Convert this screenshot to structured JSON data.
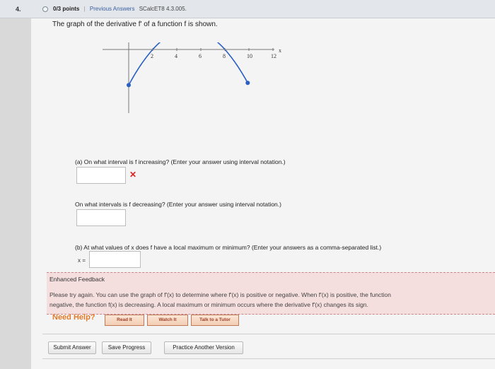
{
  "header": {
    "question_number": "4.",
    "points": "0/3 points",
    "separator": "|",
    "previous_answers": "Previous Answers",
    "problem_code": "SCalcET8 4.3.005."
  },
  "prompt": "The graph of the derivative f' of a function f is shown.",
  "graph": {
    "tick_labels": [
      "2",
      "4",
      "6",
      "8",
      "10",
      "12"
    ],
    "axis_label": "x"
  },
  "part_a": {
    "question_increasing": "(a) On what interval is f increasing? (Enter your answer using interval notation.)",
    "answer_increasing": "",
    "question_decreasing": "On what intervals is f decreasing? (Enter your answer using interval notation.)",
    "answer_decreasing": ""
  },
  "part_b": {
    "question": "(b) At what values of x does f have a local maximum or minimum? (Enter your answers as a comma-separated list.)",
    "x_label": "x =",
    "answer": ""
  },
  "feedback": {
    "title": "Enhanced Feedback",
    "line1": "Please try again. You can use the graph of f'(x) to determine where f'(x) is positive or negative. When f'(x) is positive, the function",
    "line2": "negative, the function f(x) is decreasing. A local maximum or minimum occurs where the derivative f'(x) changes its sign."
  },
  "help": {
    "label": "Need Help?",
    "read_it": "Read It",
    "watch_it": "Watch It",
    "talk_to_tutor": "Talk to a Tutor"
  },
  "footer": {
    "submit": "Submit Answer",
    "save": "Save Progress",
    "practice": "Practice Another Version"
  },
  "colors": {
    "curve": "#2a5fc4",
    "error": "#dd2222",
    "feedback_bg": "#f5dede",
    "help": "#e07b2a"
  }
}
